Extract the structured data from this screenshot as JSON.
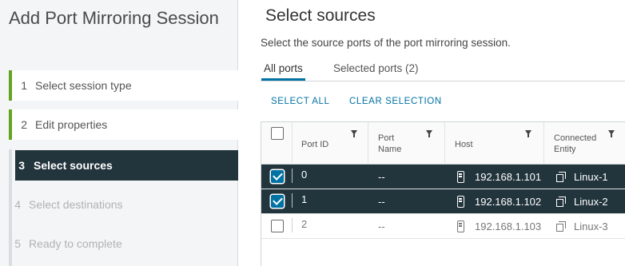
{
  "wizard": {
    "title": "Add Port Mirroring Session",
    "steps": [
      {
        "num": "1",
        "label": "Select session type",
        "state": "done"
      },
      {
        "num": "2",
        "label": "Edit properties",
        "state": "done"
      },
      {
        "num": "3",
        "label": "Select sources",
        "state": "active"
      },
      {
        "num": "4",
        "label": "Select destinations",
        "state": "pending"
      },
      {
        "num": "5",
        "label": "Ready to complete",
        "state": "pending"
      }
    ]
  },
  "main": {
    "title": "Select sources",
    "description": "Select the source ports of the port mirroring session.",
    "tabs": [
      {
        "label": "All ports",
        "active": true
      },
      {
        "label": "Selected ports (2)",
        "active": false
      }
    ],
    "actions": {
      "select_all": "SELECT ALL",
      "clear_selection": "CLEAR SELECTION"
    },
    "grid": {
      "columns": {
        "port_id": "Port ID",
        "port_name_line1": "Port",
        "port_name_line2": "Name",
        "host": "Host",
        "entity_line1": "Connected",
        "entity_line2": "Entity"
      },
      "rows": [
        {
          "port_id": "0",
          "port_name": "--",
          "host": "192.168.1.101",
          "entity": "Linux-1",
          "selected": true
        },
        {
          "port_id": "1",
          "port_name": "--",
          "host": "192.168.1.102",
          "entity": "Linux-2",
          "selected": true
        },
        {
          "port_id": "2",
          "port_name": "--",
          "host": "192.168.1.103",
          "entity": "Linux-3",
          "selected": false
        }
      ]
    }
  },
  "colors": {
    "accent": "#0072a3",
    "selected_row": "#22343c",
    "done_step": "#62a420"
  }
}
